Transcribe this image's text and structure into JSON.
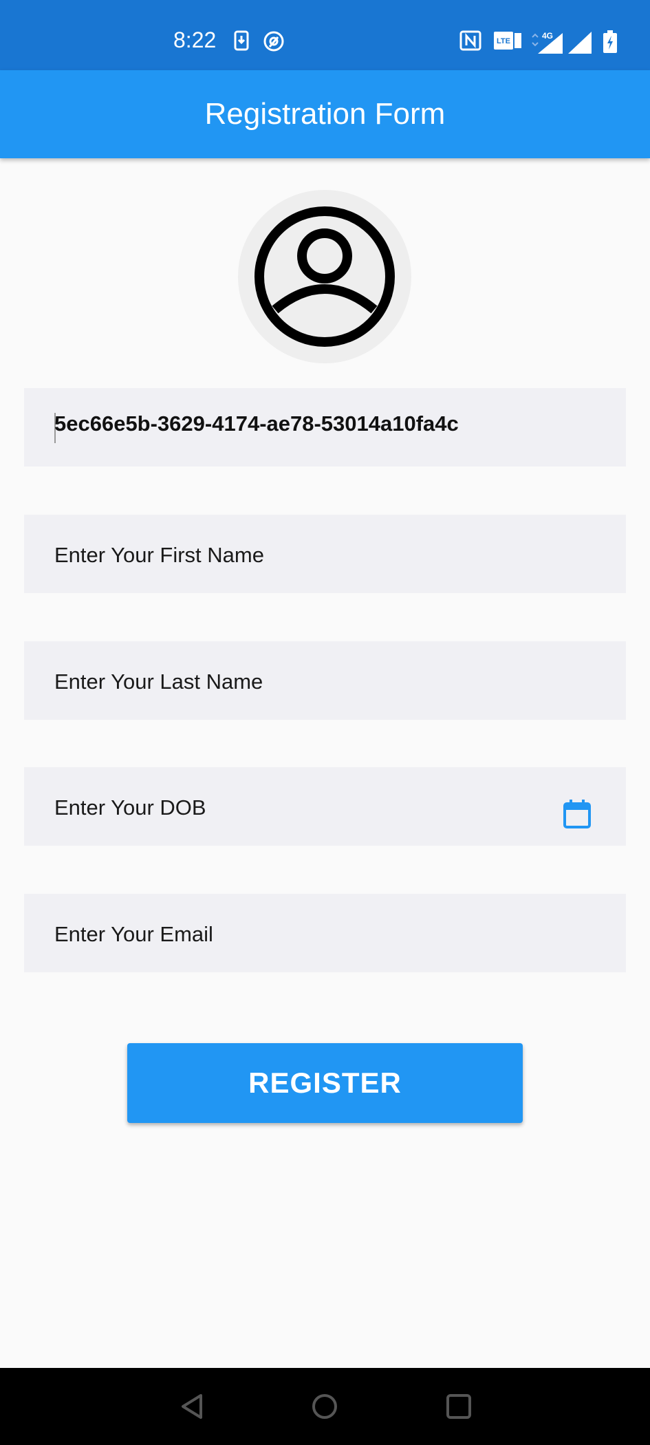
{
  "status_bar": {
    "time": "8:22",
    "icons": [
      "download-icon",
      "at-sign-icon",
      "nfc-icon",
      "volte-icon",
      "signal-4g-icon",
      "signal-icon",
      "battery-charging-icon"
    ]
  },
  "app_bar": {
    "title": "Registration Form"
  },
  "avatar": {
    "icon": "account-circle-icon"
  },
  "form": {
    "id_value": "5ec66e5b-3629-4174-ae78-53014a10fa4c",
    "first_name_placeholder": "Enter Your First Name",
    "last_name_placeholder": "Enter Your Last Name",
    "dob_placeholder": "Enter Your DOB",
    "email_placeholder": "Enter Your Email",
    "register_label": "REGISTER"
  },
  "colors": {
    "status_bar": "#1976d2",
    "app_bar": "#2196f3",
    "button": "#2196f3",
    "field_bg": "#f0f0f4",
    "background": "#fafafa"
  },
  "nav_bar": {
    "icons": [
      "back-icon",
      "home-icon",
      "recents-icon"
    ]
  }
}
